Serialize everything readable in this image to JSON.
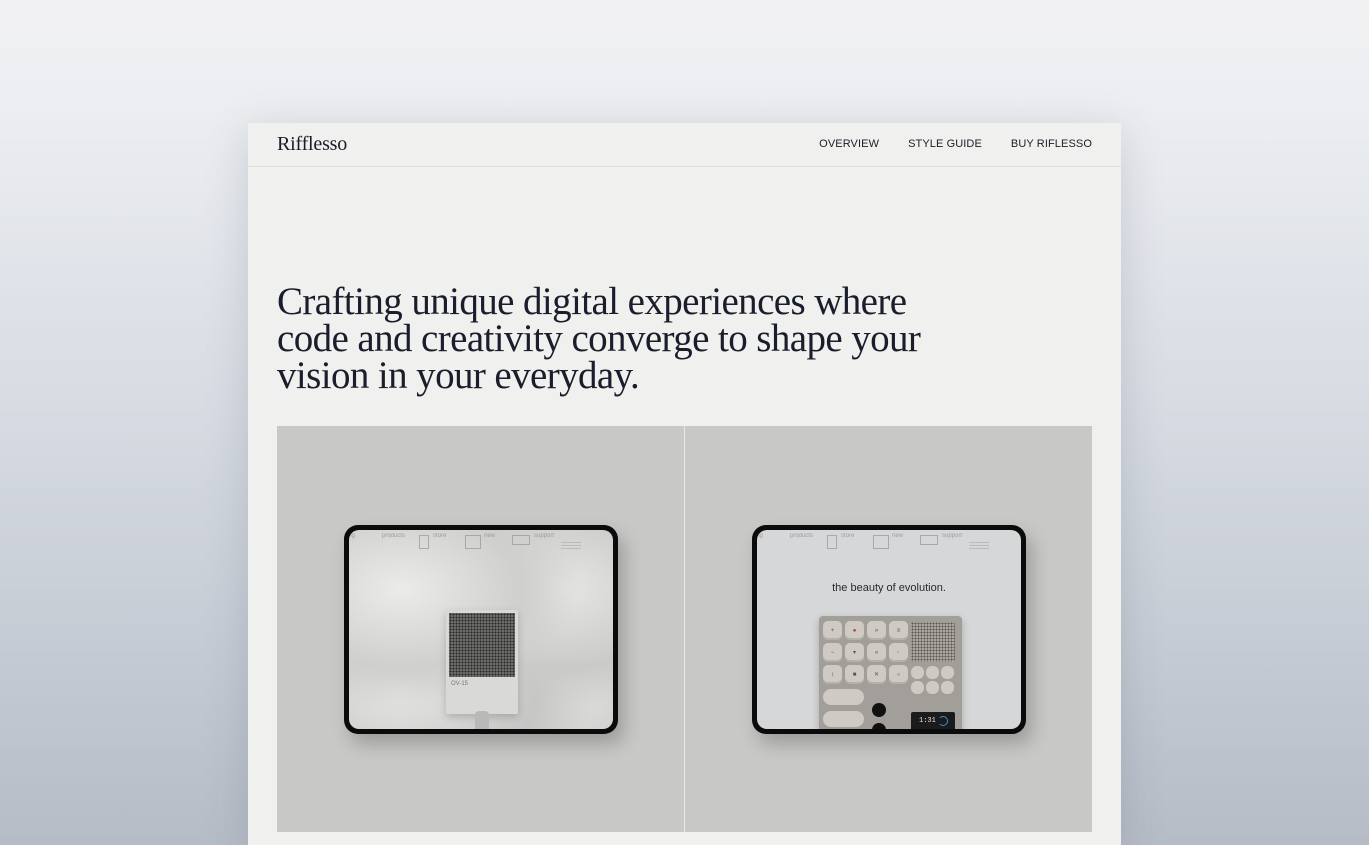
{
  "brand": {
    "logo": "Rifflesso"
  },
  "nav": {
    "items": [
      {
        "label": "OVERVIEW"
      },
      {
        "label": "STYLE GUIDE"
      },
      {
        "label": "BUY RIFLESSO"
      }
    ]
  },
  "hero": {
    "heading": "Crafting unique digital experiences where code and creativity converge to shape your vision in your everyday."
  },
  "gallery": {
    "left_panel": {
      "mini_nav": [
        "ring",
        "products",
        "store",
        "new",
        "support"
      ],
      "product_label": "OV-15"
    },
    "right_panel": {
      "mini_nav": [
        "ring",
        "products",
        "store",
        "new",
        "support"
      ],
      "caption": "the beauty of evolution.",
      "display_readout": "1:31"
    }
  }
}
